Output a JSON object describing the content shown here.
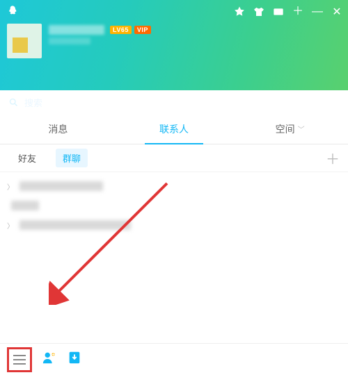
{
  "header": {
    "badges": {
      "lv": "LV65",
      "vip": "VIP"
    }
  },
  "search": {
    "placeholder": "搜索"
  },
  "main_tabs": {
    "messages": "消息",
    "contacts": "联系人",
    "space": "空间"
  },
  "sub_tabs": {
    "friends": "好友",
    "groups": "群聊"
  }
}
